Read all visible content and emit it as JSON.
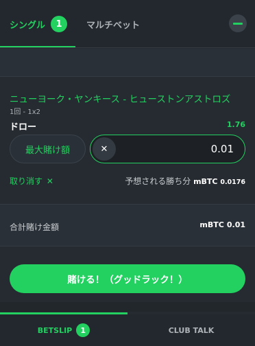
{
  "header": {
    "tabs": [
      {
        "label": "シングル",
        "count": "1",
        "active": true
      },
      {
        "label": "マルチベット",
        "active": false
      }
    ],
    "collapse_icon": "minus-icon"
  },
  "bet": {
    "match": "ニューヨーク・ヤンキース - ヒューストンアストロズ",
    "market": "1回 - 1x2",
    "selection": "ドロー",
    "odds": "1.76",
    "max_bet_label": "最大賭け額",
    "clear_glyph": "✕",
    "stake": "0.01",
    "cancel_label": "取り消す",
    "cancel_glyph": "✕",
    "payout_label": "予想される勝ち分",
    "payout_currency": "mBTC",
    "payout_value": "0.0176"
  },
  "summary": {
    "total_label": "合計賭け金額",
    "total_currency": "mBTC",
    "total_value": "0.01"
  },
  "place_bet_label": "賭ける！（グッドラック！）",
  "bottom_tabs": [
    {
      "label": "BETSLIP",
      "count": "1",
      "active": true
    },
    {
      "label": "CLUB TALK",
      "active": false
    }
  ],
  "colors": {
    "accent": "#23d160",
    "background": "#252b31"
  }
}
